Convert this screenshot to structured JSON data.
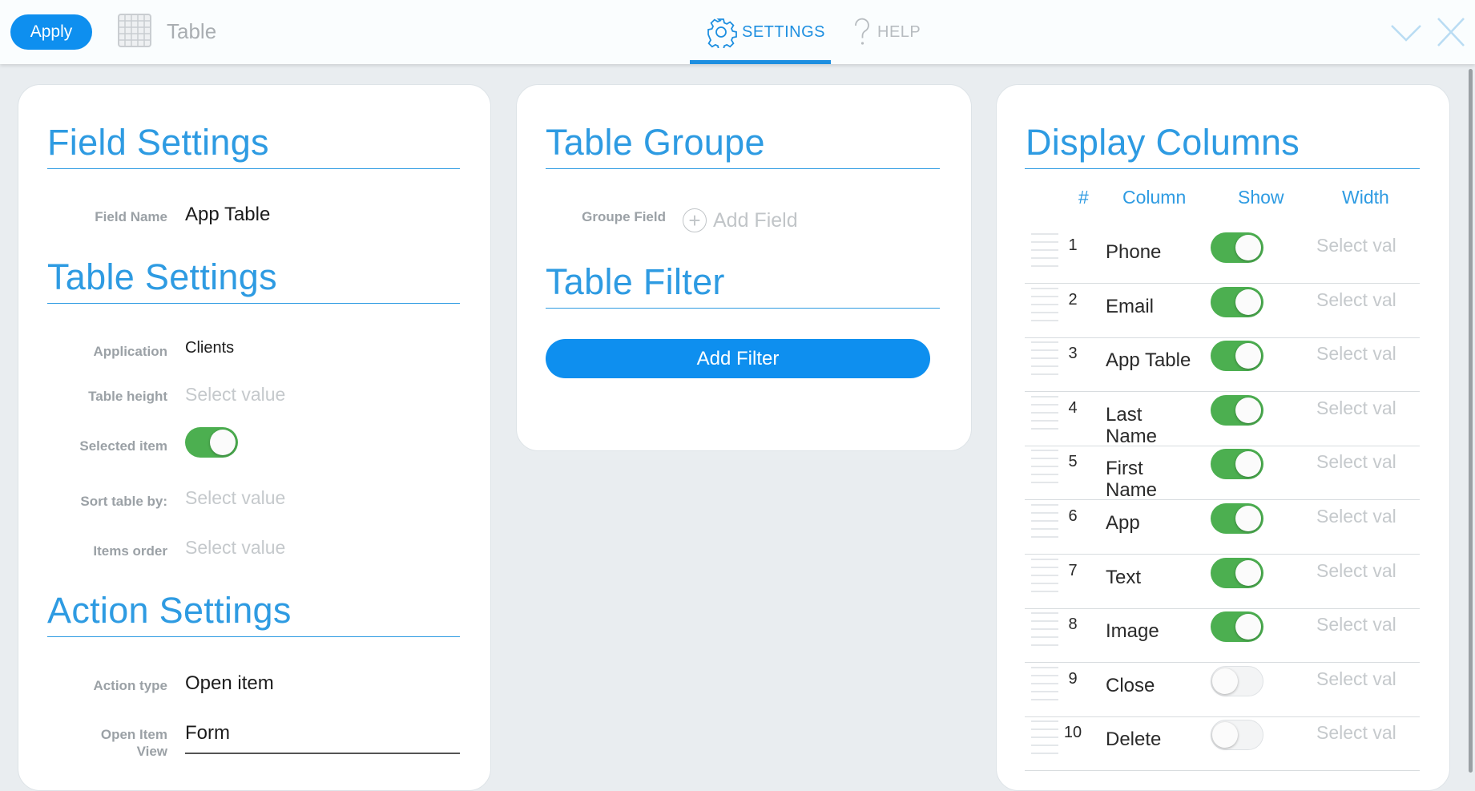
{
  "topbar": {
    "apply_label": "Apply",
    "field_title": "Table",
    "tabs": [
      {
        "label": "SETTINGS",
        "active": true
      },
      {
        "label": "HELP",
        "active": false
      }
    ],
    "accent_color": "#0e8fef"
  },
  "field_settings": {
    "title": "Field Settings",
    "field_name_label": "Field Name",
    "field_name_value": "App Table"
  },
  "table_settings": {
    "title": "Table Settings",
    "application_label": "Application",
    "application_value": "Clients",
    "table_height_label": "Table height",
    "table_height_placeholder": "Select value",
    "selected_item_label": "Selected item",
    "selected_item_on": true,
    "sort_label": "Sort table by:",
    "sort_placeholder": "Select value",
    "items_order_label": "Items order",
    "items_order_placeholder": "Select value"
  },
  "action_settings": {
    "title": "Action Settings",
    "action_type_label": "Action type",
    "action_type_value": "Open item",
    "open_item_view_label_1": "Open Item",
    "open_item_view_label_2": "View",
    "open_item_view_value": "Form"
  },
  "table_groupe": {
    "title": "Table Groupe",
    "groupe_field_label": "Groupe Field",
    "add_field_label": "Add Field"
  },
  "table_filter": {
    "title": "Table Filter",
    "add_filter_label": "Add Filter"
  },
  "display_columns": {
    "title": "Display Columns",
    "headers": {
      "num": "#",
      "column": "Column",
      "show": "Show",
      "width": "Width"
    },
    "width_placeholder": "Select val",
    "rows": [
      {
        "num": "1",
        "name": "Phone",
        "show": true
      },
      {
        "num": "2",
        "name": "Email",
        "show": true
      },
      {
        "num": "3",
        "name": "App Table",
        "show": true
      },
      {
        "num": "4",
        "name": "Last Name",
        "show": true
      },
      {
        "num": "5",
        "name": "First Name",
        "show": true
      },
      {
        "num": "6",
        "name": "App",
        "show": true
      },
      {
        "num": "7",
        "name": "Text",
        "show": true
      },
      {
        "num": "8",
        "name": "Image",
        "show": true
      },
      {
        "num": "9",
        "name": "Close",
        "show": false
      },
      {
        "num": "10",
        "name": "Delete",
        "show": false
      }
    ],
    "toggle_on_color": "#4caf50"
  }
}
